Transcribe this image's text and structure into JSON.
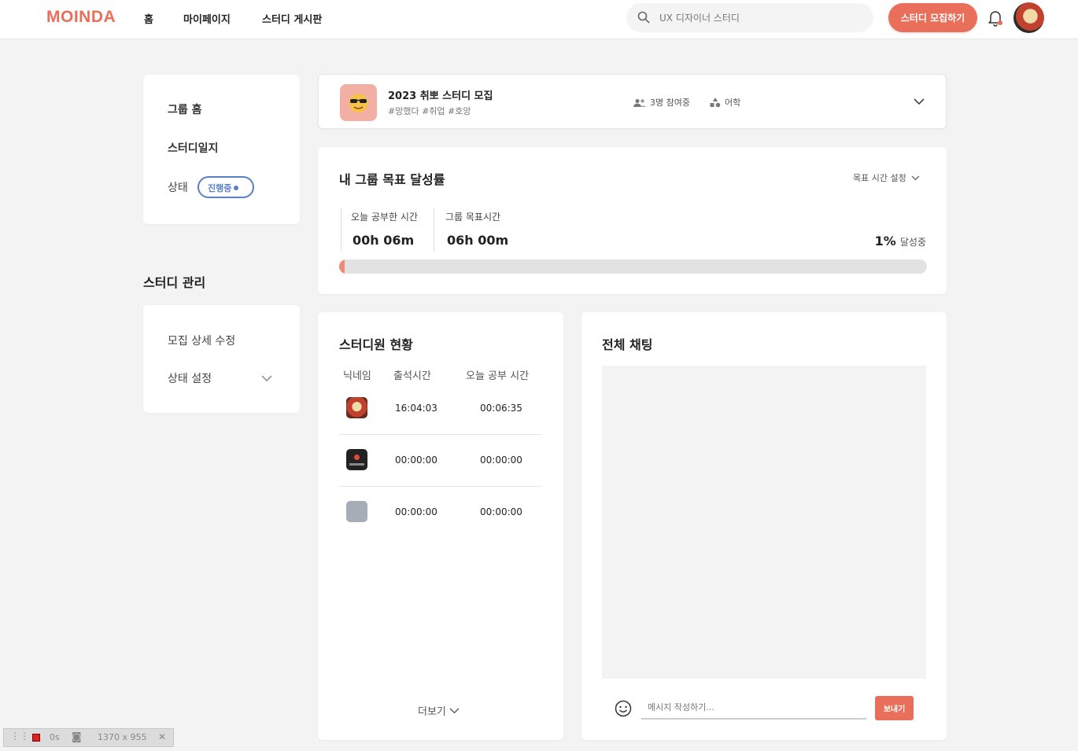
{
  "header": {
    "logo": "MOINDA",
    "nav": [
      "홈",
      "마이페이지",
      "스터디 게시판"
    ],
    "search_placeholder": "UX 디자이너 스터디",
    "recruit_button": "스터디 모집하기"
  },
  "sidebar": {
    "items": [
      "그룹 홈",
      "스터디일지"
    ],
    "status_label": "상태",
    "status_badge": "진행중",
    "manage_title": "스터디 관리",
    "manage_items": [
      "모집 상세 수정",
      "상태 설정"
    ]
  },
  "study": {
    "title": "2023 취뽀 스터디 모집",
    "tags": "#망했다 #취업 #호앙",
    "participants": "3명 참여중",
    "category": "어학"
  },
  "goal": {
    "title": "내 그룹 목표 달성률",
    "setting_label": "목표 시간 설정",
    "today_label": "오늘 공부한 시간",
    "today_value": "00h 06m",
    "target_label": "그룹 목표시간",
    "target_value": "06h 00m",
    "percent": "1%",
    "percent_suffix": "달성중",
    "progress_fraction": 0.01
  },
  "members": {
    "title": "스터디원 현황",
    "columns": [
      "닉네임",
      "출석시간",
      "오늘 공부 시간"
    ],
    "rows": [
      {
        "attendance": "16:04:03",
        "study": "00:06:35"
      },
      {
        "attendance": "00:00:00",
        "study": "00:00:00"
      },
      {
        "attendance": "00:00:00",
        "study": "00:00:00"
      }
    ],
    "more_label": "더보기"
  },
  "chat": {
    "title": "전체 채팅",
    "input_placeholder": "메시지 작성하기...",
    "send_label": "보내기"
  },
  "devtools": {
    "time": "0s",
    "size": "1370 x 955"
  },
  "colors": {
    "accent": "#ea6f5a",
    "status_blue": "#5a7fc7"
  }
}
